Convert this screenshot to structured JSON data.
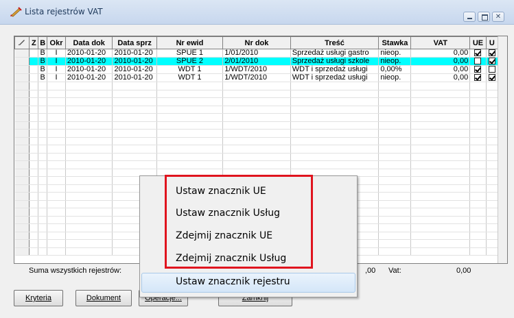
{
  "window": {
    "title": "Lista rejestrów VAT",
    "buttons": {
      "minimize": "─",
      "maximize": "□",
      "close": "✕"
    }
  },
  "grid": {
    "columns": [
      "",
      "Z",
      "B",
      "Okr",
      "Data dok",
      "Data sprz",
      "Nr ewid",
      "Nr dok",
      "Treść",
      "Stawka",
      "VAT",
      "UE",
      "U"
    ],
    "rows": [
      {
        "z": "",
        "b": "B",
        "okr": "I",
        "data_dok": "2010-01-20",
        "data_sprz": "2010-01-20",
        "nr_ewid": "SPUE 1",
        "nr_dok": "1/01/2010",
        "tresc": "Sprzedaż usługi gastro",
        "stawka": "nieop.",
        "vat": "0,00",
        "ue": true,
        "u": true,
        "highlighted": false
      },
      {
        "z": "",
        "b": "B",
        "okr": "I",
        "data_dok": "2010-01-20",
        "data_sprz": "2010-01-20",
        "nr_ewid": "SPUE 2",
        "nr_dok": "2/01/2010",
        "tresc": "Sprzedaż usługi szkole",
        "stawka": "nieop.",
        "vat": "0,00",
        "ue": false,
        "u": true,
        "highlighted": true
      },
      {
        "z": "",
        "b": "B",
        "okr": "I",
        "data_dok": "2010-01-20",
        "data_sprz": "2010-01-20",
        "nr_ewid": "WDT 1",
        "nr_dok": "1/WDT/2010",
        "tresc": "WDT i sprzedaż usługi",
        "stawka": "0,00%",
        "vat": "0,00",
        "ue": true,
        "u": false,
        "highlighted": false
      },
      {
        "z": "",
        "b": "B",
        "okr": "I",
        "data_dok": "2010-01-20",
        "data_sprz": "2010-01-20",
        "nr_ewid": "WDT 1",
        "nr_dok": "1/WDT/2010",
        "tresc": "WDT i sprzedaż usługi",
        "stawka": "nieop.",
        "vat": "0,00",
        "ue": true,
        "u": true,
        "highlighted": false
      }
    ],
    "empty_row_count": 22
  },
  "summary": {
    "label": "Suma wszystkich rejestrów:",
    "value": ",00",
    "vat_label": "Vat:",
    "vat_value": "0,00"
  },
  "buttons": {
    "kryteria": "Kryteria",
    "dokument": "Dokument",
    "operacje": "Operacje...",
    "zamknij": "Zamknij"
  },
  "context_menu": {
    "items": [
      "Ustaw znacznik UE",
      "Ustaw znacznik Usług",
      "Zdejmij znacznik UE",
      "Zdejmij znacznik Usług",
      "Ustaw znacznik rejestru"
    ],
    "hovered_index": 4
  },
  "colors": {
    "highlight_row": "#00ffff",
    "annotation": "#e0141e"
  }
}
